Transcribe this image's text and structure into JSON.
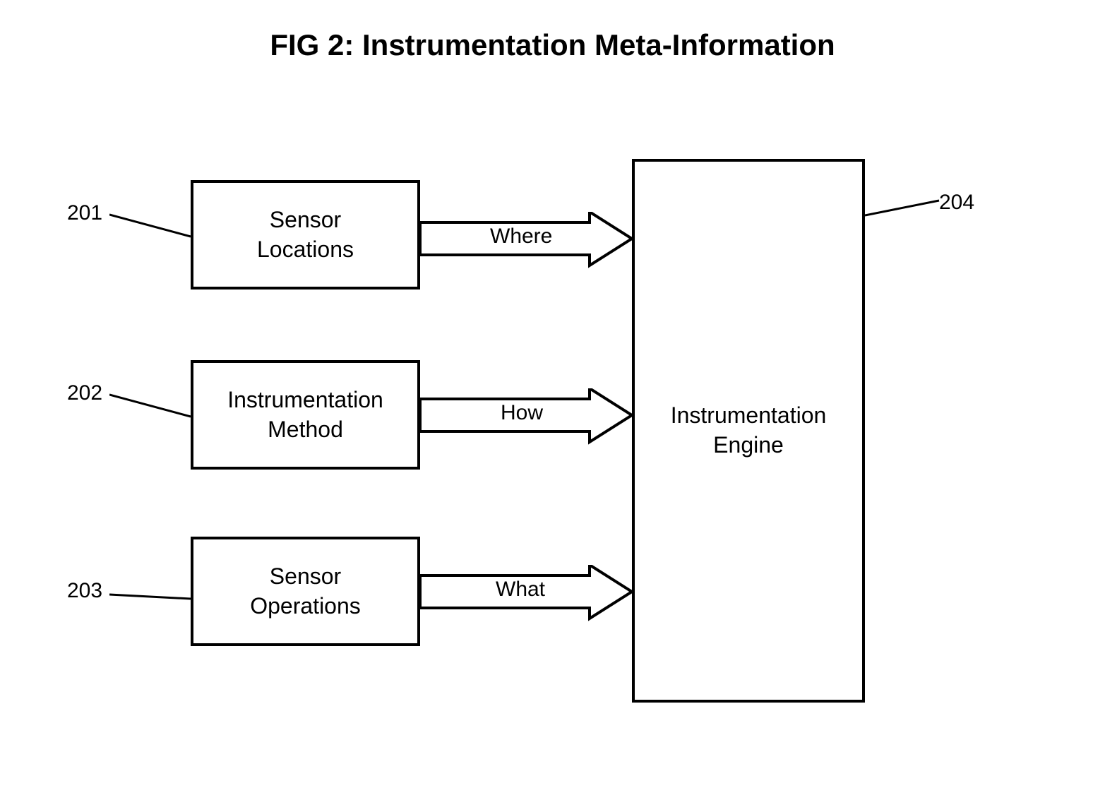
{
  "title": "FIG 2: Instrumentation Meta-Information",
  "boxes": {
    "sensor_locations": {
      "label": "Sensor\nLocations",
      "ref": "201"
    },
    "instrumentation_method": {
      "label": "Instrumentation\nMethod",
      "ref": "202"
    },
    "sensor_operations": {
      "label": "Sensor\nOperations",
      "ref": "203"
    },
    "engine": {
      "label": "Instrumentation\nEngine",
      "ref": "204"
    }
  },
  "arrows": {
    "where": "Where",
    "how": "How",
    "what": "What"
  }
}
